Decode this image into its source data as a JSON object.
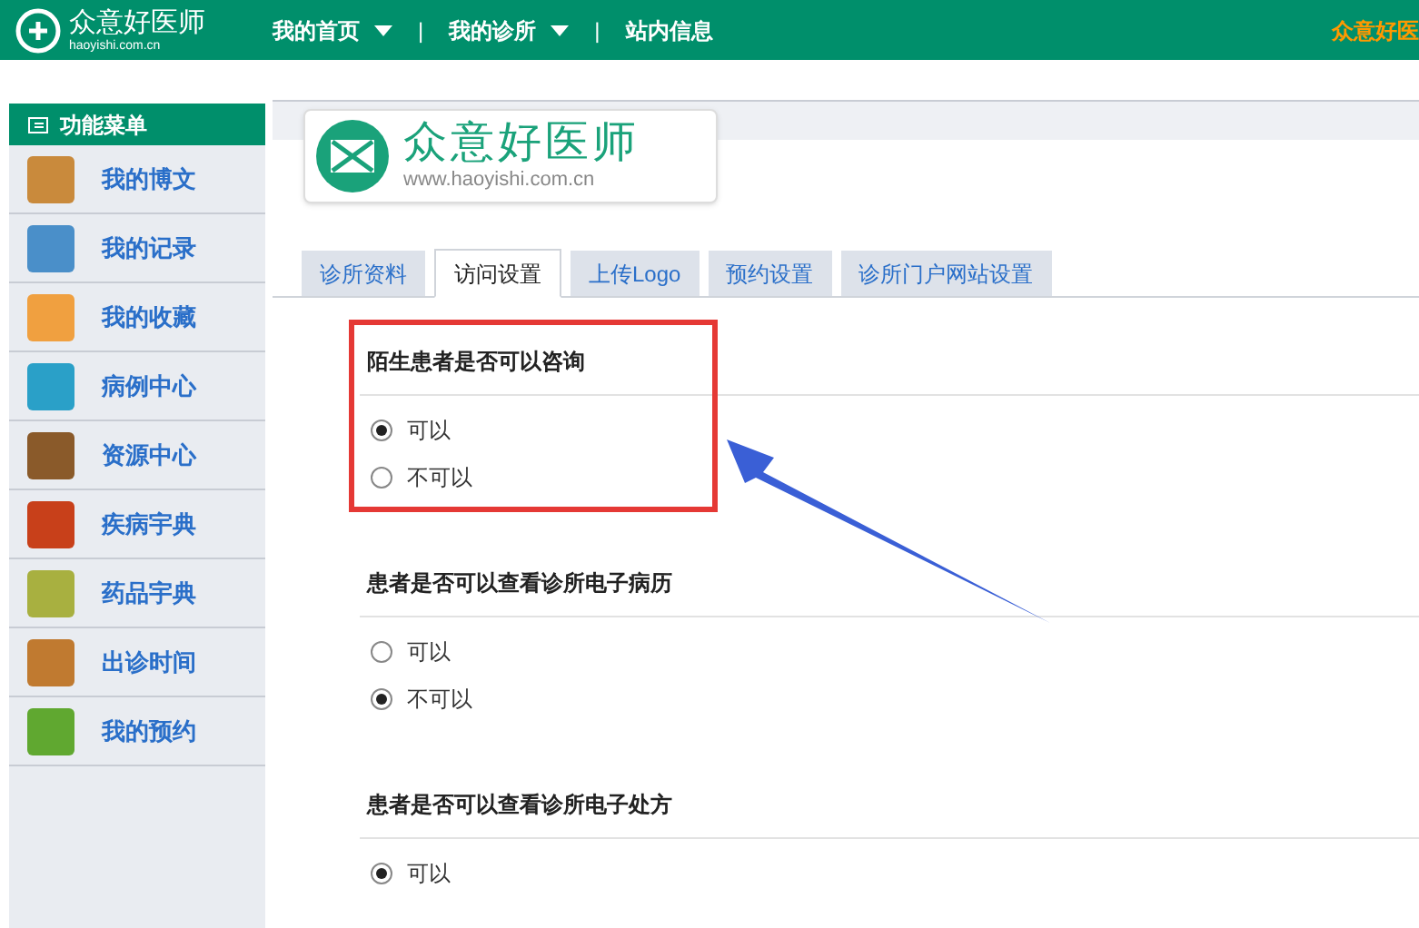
{
  "header": {
    "brand": "众意好医师",
    "brand_url": "haoyishi.com.cn",
    "nav": [
      {
        "label": "我的首页",
        "dropdown": true
      },
      {
        "label": "我的诊所",
        "dropdown": true
      },
      {
        "label": "站内信息",
        "dropdown": false
      }
    ],
    "separators": [
      "|",
      "|"
    ],
    "right_text": "众意好医"
  },
  "sidebar": {
    "title": "功能菜单",
    "items": [
      {
        "label": "我的博文",
        "color": "#c98a3c"
      },
      {
        "label": "我的记录",
        "color": "#4a8fc9"
      },
      {
        "label": "我的收藏",
        "color": "#f0a040"
      },
      {
        "label": "病例中心",
        "color": "#2aa0c8"
      },
      {
        "label": "资源中心",
        "color": "#8a5a2a"
      },
      {
        "label": "疾病宇典",
        "color": "#c8401a"
      },
      {
        "label": "药品宇典",
        "color": "#a8b040"
      },
      {
        "label": "出诊时间",
        "color": "#c07a30"
      },
      {
        "label": "我的预约",
        "color": "#60a830"
      }
    ]
  },
  "logo": {
    "name": "众意好医师",
    "url": "www.haoyishi.com.cn"
  },
  "tabs": [
    {
      "label": "诊所资料",
      "selected": false
    },
    {
      "label": "访问设置",
      "selected": true
    },
    {
      "label": "上传Logo",
      "selected": false
    },
    {
      "label": "预约设置",
      "selected": false
    },
    {
      "label": "诊所门户网站设置",
      "selected": false
    }
  ],
  "sections": [
    {
      "title": "陌生患者是否可以咨询",
      "highlighted": true,
      "options": [
        {
          "label": "可以",
          "selected": true
        },
        {
          "label": "不可以",
          "selected": false
        }
      ]
    },
    {
      "title": "患者是否可以查看诊所电子病历",
      "highlighted": false,
      "options": [
        {
          "label": "可以",
          "selected": false
        },
        {
          "label": "不可以",
          "selected": true
        }
      ]
    },
    {
      "title": "患者是否可以查看诊所电子处方",
      "highlighted": false,
      "options": [
        {
          "label": "可以",
          "selected": true
        }
      ]
    }
  ]
}
